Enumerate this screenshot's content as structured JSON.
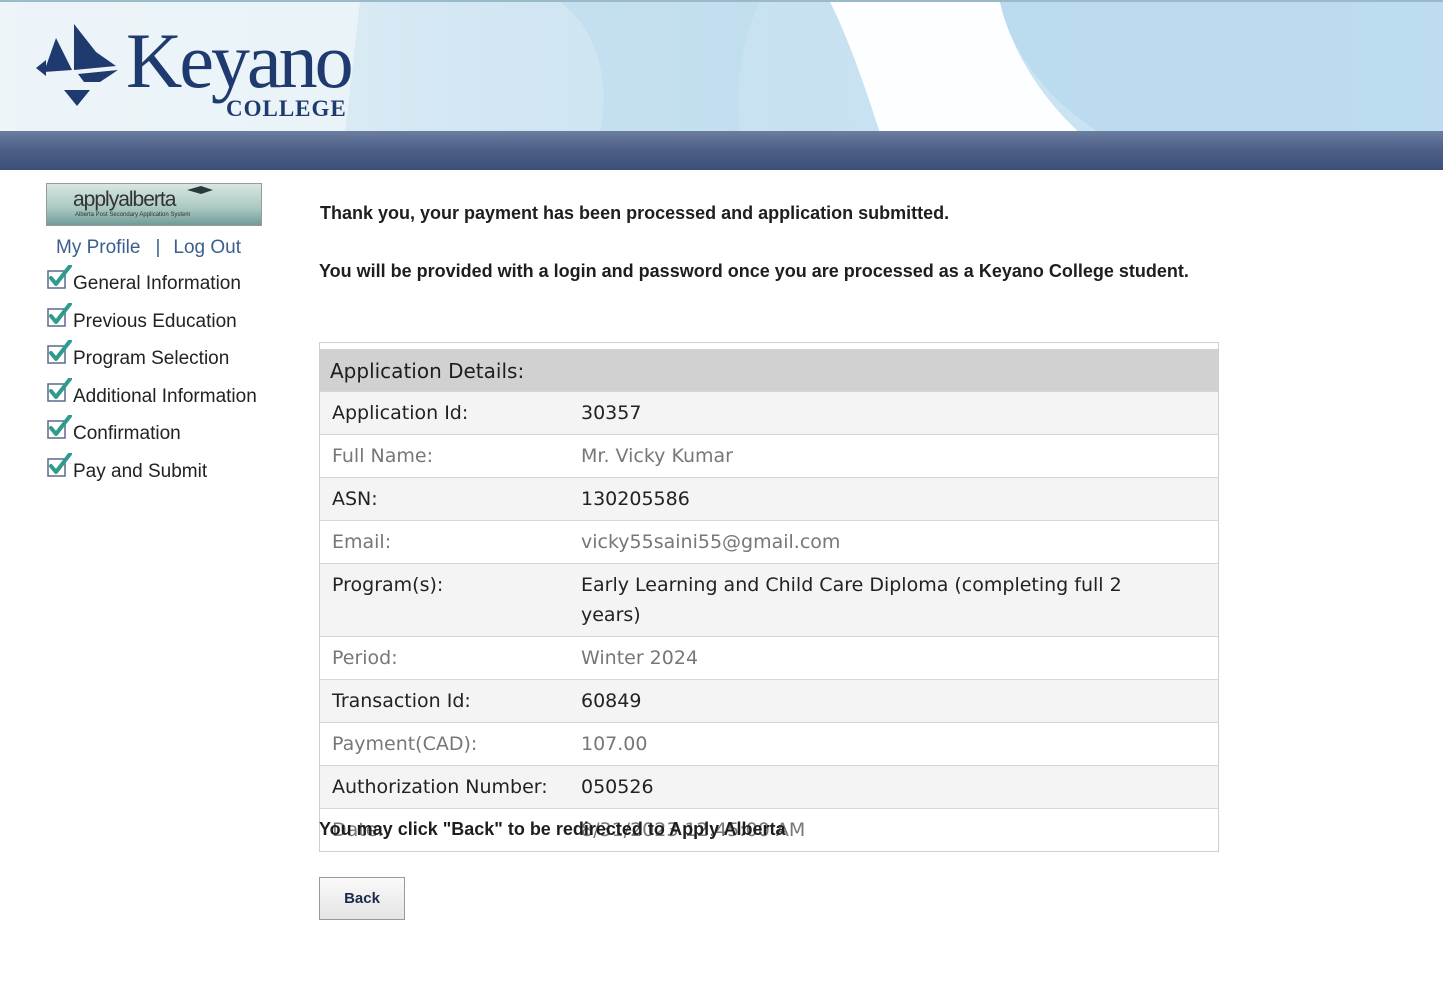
{
  "header": {
    "brand_word": "Keyano",
    "brand_sub": "COLLEGE",
    "colors": {
      "brand": "#1f3a6e",
      "bar": "#4e6189"
    }
  },
  "sidebar": {
    "apply_logo": {
      "word": "applyalberta",
      "subtitle": "Alberta Post Secondary Application System"
    },
    "links": {
      "profile": "My Profile",
      "separator": "|",
      "logout": "Log Out"
    },
    "steps": [
      {
        "label": "General Information",
        "icon": "checkmark-icon"
      },
      {
        "label": "Previous Education",
        "icon": "checkmark-icon"
      },
      {
        "label": "Program Selection",
        "icon": "checkmark-icon"
      },
      {
        "label": "Additional Information",
        "icon": "checkmark-icon"
      },
      {
        "label": "Confirmation",
        "icon": "checkmark-icon"
      },
      {
        "label": "Pay and Submit",
        "icon": "checkmark-icon"
      }
    ]
  },
  "main": {
    "thank_you": "Thank you, your payment has been processed and application submitted.",
    "login_notice": "You will be provided with a login and password once you are processed as a Keyano College student.",
    "details": {
      "heading": "Application Details:",
      "rows": [
        {
          "label": "Application Id:",
          "value": "30357"
        },
        {
          "label": "Full Name:",
          "value": "Mr. Vicky Kumar"
        },
        {
          "label": "ASN:",
          "value": "130205586"
        },
        {
          "label": "Email:",
          "value": "vicky55saini55@gmail.com"
        },
        {
          "label": "Program(s):",
          "value": "Early Learning and Child Care Diploma (completing full 2 years)"
        },
        {
          "label": "Period:",
          "value": "Winter 2024"
        },
        {
          "label": "Transaction Id:",
          "value": "60849"
        },
        {
          "label": "Payment(CAD):",
          "value": "107.00"
        },
        {
          "label": "Authorization Number:",
          "value": "050526"
        },
        {
          "label": "Date:",
          "value": "8/31/2023 12:45:00 AM"
        }
      ]
    },
    "redirect_note": "You may click \"Back\" to be redirected to Apply Alberta",
    "back_label": "Back"
  }
}
